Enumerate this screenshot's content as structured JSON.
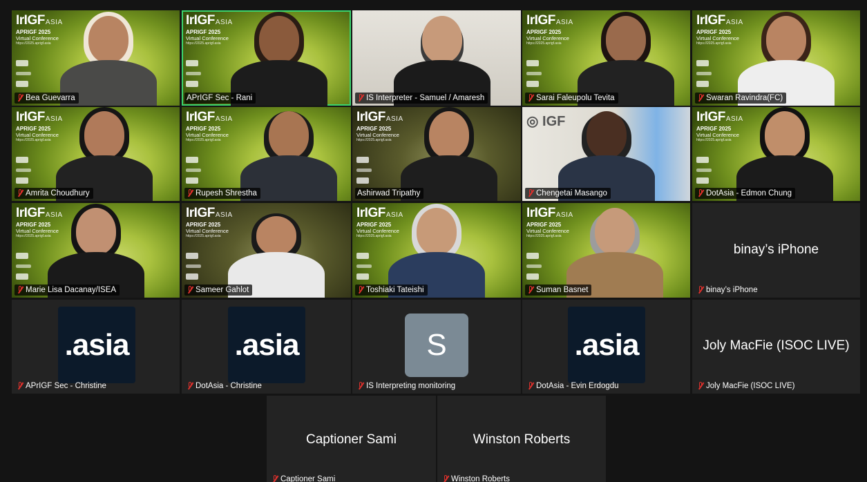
{
  "brand": {
    "logo": "IrIGF",
    "logo_suffix": "ASIA",
    "event": "APRIGF 2025",
    "event_sub": "Virtual Conference",
    "url": "https://2025.aprigf.asia"
  },
  "un_logo": "IGF",
  "row1": [
    {
      "name": "Bea Guevarra"
    },
    {
      "name": "APrIGF Sec - Rani"
    },
    {
      "name": "IS Interpreter - Samuel / Amaresh"
    },
    {
      "name": "Sarai Faleupolu Tevita"
    },
    {
      "name": "Swaran Ravindra(FC)"
    }
  ],
  "row2": [
    {
      "name": "Amrita Choudhury"
    },
    {
      "name": "Rupesh Shrestha"
    },
    {
      "name": "Ashirwad Tripathy"
    },
    {
      "name": "Chengetai Masango"
    },
    {
      "name": "DotAsia - Edmon Chung"
    }
  ],
  "row3": [
    {
      "name": "Marie Lisa Dacanay/ISEA"
    },
    {
      "name": "Sameer Gahlot"
    },
    {
      "name": "Toshiaki Tateishi"
    },
    {
      "name": "Suman Basnet"
    },
    {
      "name": "binay’s iPhone",
      "display": "binay’s iPhone"
    }
  ],
  "row4": [
    {
      "name": "APrIGF Sec - Christine",
      "logo": ".asia"
    },
    {
      "name": "DotAsia - Christine",
      "logo": ".asia"
    },
    {
      "name": "IS Interpreting monitoring",
      "initial": "S"
    },
    {
      "name": "DotAsia - Evin Erdogdu",
      "logo": ".asia"
    },
    {
      "name": "Joly MacFie (ISOC LIVE)",
      "display": "Joly MacFie (ISOC LIVE)"
    }
  ],
  "row5": [
    {
      "name": "Captioner Sami",
      "display": "Captioner Sami"
    },
    {
      "name": "Winston Roberts",
      "display": "Winston Roberts"
    }
  ],
  "colors": {
    "active_border": "#3bd36e",
    "mic_muted": "#e0302c",
    "asia_bg": "#0c1a2a"
  }
}
